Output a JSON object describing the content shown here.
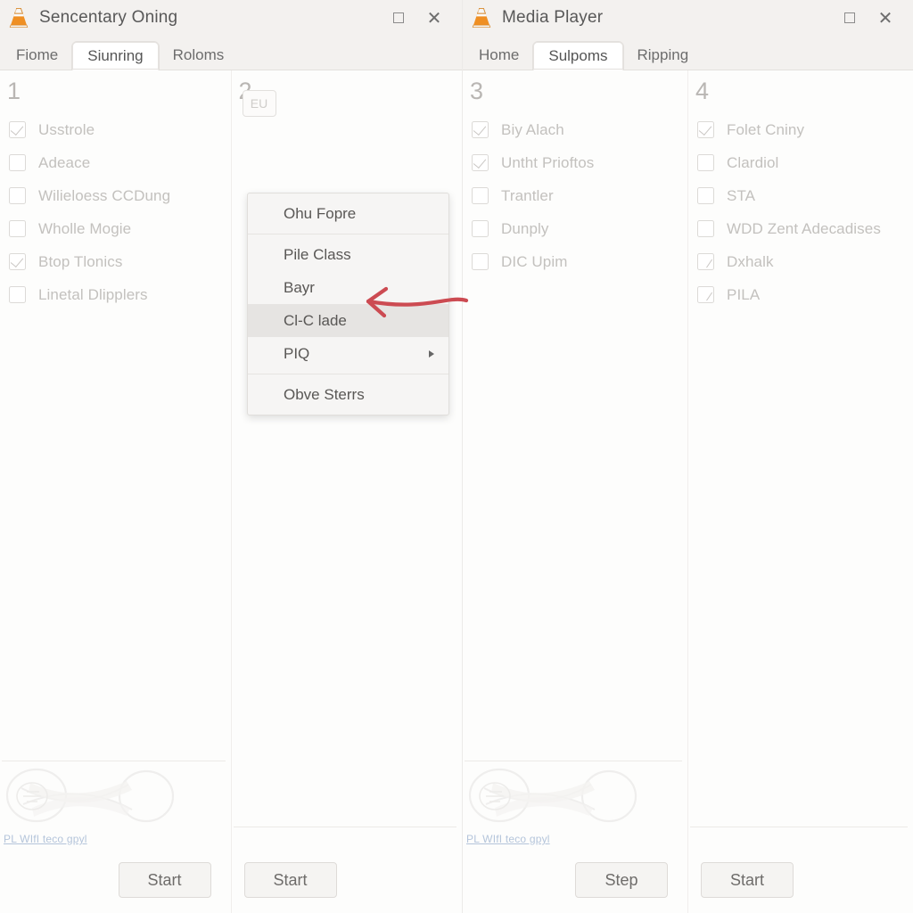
{
  "windows": [
    {
      "title": "Sencentary Oning",
      "icon": "vlc-cone-icon",
      "controls": {
        "maximize": "maximize-icon",
        "close": "close-icon"
      },
      "tabs": [
        {
          "label": "Fiome",
          "active": false
        },
        {
          "label": "Siunring",
          "active": true
        },
        {
          "label": "Roloms",
          "active": false
        }
      ],
      "columns": [
        {
          "number": "1",
          "items": [
            {
              "label": "Usstrole",
              "state": "checked"
            },
            {
              "label": "Adeace",
              "state": "unchecked"
            },
            {
              "label": "Wilieloess CCDung",
              "state": "unchecked"
            },
            {
              "label": "Wholle Mogie",
              "state": "unchecked"
            },
            {
              "label": "Btop Tlonics",
              "state": "checked"
            },
            {
              "label": "Linetal Dlipplers",
              "state": "unchecked"
            }
          ],
          "footer": {
            "logo": "vlc-wordmark-logo",
            "link": "PL WIfI teco gpyl",
            "button": "Start",
            "button_align": "right"
          }
        },
        {
          "number": "2",
          "items": [],
          "ghost_widget": "EU",
          "footer": {
            "logo": null,
            "link": null,
            "button": "Start",
            "button_align": "left"
          }
        }
      ],
      "context_menu": {
        "items": [
          {
            "label": "Ohu Fopre",
            "highlight": false,
            "submenu": false,
            "separator_after": true
          },
          {
            "label": "Pile Class",
            "highlight": false,
            "submenu": false,
            "separator_after": false
          },
          {
            "label": "Bayr",
            "highlight": false,
            "submenu": false,
            "separator_after": false
          },
          {
            "label": "Cl-C lade",
            "highlight": true,
            "submenu": false,
            "separator_after": false
          },
          {
            "label": "PIQ",
            "highlight": false,
            "submenu": true,
            "separator_after": true
          },
          {
            "label": "Obve Sterrs",
            "highlight": false,
            "submenu": false,
            "separator_after": false
          }
        ],
        "annotation": {
          "type": "red-arrow",
          "points_to": "Cl-C lade",
          "color": "#cc4b52"
        }
      }
    },
    {
      "title": "Media Player",
      "icon": "vlc-cone-icon",
      "controls": {
        "maximize": "maximize-icon",
        "close": "close-icon"
      },
      "tabs": [
        {
          "label": "Home",
          "active": false
        },
        {
          "label": "Sulpoms",
          "active": true
        },
        {
          "label": "Ripping",
          "active": false
        }
      ],
      "columns": [
        {
          "number": "3",
          "items": [
            {
              "label": "Biy Alach",
              "state": "checked"
            },
            {
              "label": "Untht Prioftos",
              "state": "checked"
            },
            {
              "label": "Trantler",
              "state": "unchecked"
            },
            {
              "label": "Dunply",
              "state": "unchecked"
            },
            {
              "label": "DIC Upim",
              "state": "unchecked"
            }
          ],
          "footer": {
            "logo": "vlc-wordmark-logo",
            "link": "РL WIfI teco gpyl",
            "button": "Step",
            "button_align": "right"
          }
        },
        {
          "number": "4",
          "items": [
            {
              "label": "Folet Cniny",
              "state": "checked"
            },
            {
              "label": "Clardiol",
              "state": "unchecked"
            },
            {
              "label": "STA",
              "state": "unchecked"
            },
            {
              "label": "WDD Zent Adecadises",
              "state": "unchecked"
            },
            {
              "label": "Dxhalk",
              "state": "slash"
            },
            {
              "label": "PILA",
              "state": "slash"
            }
          ],
          "footer": {
            "logo": null,
            "link": null,
            "button": "Start",
            "button_align": "left"
          }
        }
      ],
      "context_menu": null
    }
  ],
  "colors": {
    "titlebar_bg": "#f3f1ef",
    "page_bg": "#fdfdfc",
    "active_tab_bg": "#ffffff",
    "menu_bg": "#f6f5f4",
    "menu_highlight": "#e6e4e2",
    "disabled_text": "#c3c1be",
    "annotation_red": "#cc4b52",
    "link_blue": "#8ea7c9",
    "vlc_orange": "#e8820c"
  }
}
